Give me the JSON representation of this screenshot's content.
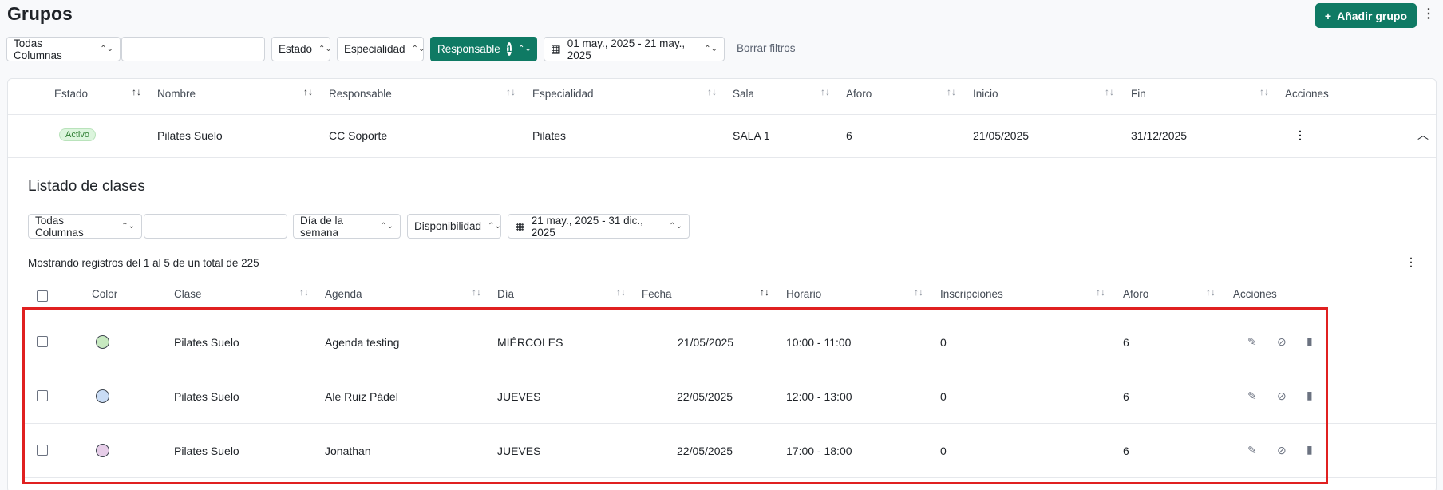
{
  "header": {
    "title": "Grupos",
    "add_label": "Añadir grupo",
    "add_icon": "plus-icon",
    "more_icon": "⋮"
  },
  "filters": {
    "column_select": "Todas Columnas",
    "search_placeholder": "",
    "estado": "Estado",
    "especialidad": "Especialidad",
    "responsable": "Responsable",
    "responsable_count": "1",
    "date_range": "01 may., 2025 - 21 may., 2025",
    "clear": "Borrar filtros"
  },
  "groups_table": {
    "columns": [
      "Estado",
      "Nombre",
      "Responsable",
      "Especialidad",
      "Sala",
      "Aforo",
      "Inicio",
      "Fin",
      "Acciones"
    ],
    "row": {
      "estado": "Activo",
      "nombre": "Pilates Suelo",
      "responsable": "CC Soporte",
      "especialidad": "Pilates",
      "sala": "SALA 1",
      "aforo": "6",
      "inicio": "21/05/2025",
      "fin": "31/12/2025",
      "actions_icon": "⋮",
      "expand_icon": "︿"
    }
  },
  "classes": {
    "title": "Listado de clases",
    "filters": {
      "column_select": "Todas Columnas",
      "dia": "Día de la semana",
      "disponibilidad": "Disponibilidad",
      "date_range": "21 may., 2025 - 31 dic., 2025"
    },
    "records_text": "Mostrando registros del 1 al 5 de un total de 225",
    "more_icon": "⋮",
    "columns": [
      "Color",
      "Clase",
      "Agenda",
      "Día",
      "Fecha",
      "Horario",
      "Inscripciones",
      "Aforo",
      "Acciones"
    ],
    "rows": [
      {
        "color": "#c7e9c0",
        "clase": "Pilates Suelo",
        "agenda": "Agenda testing",
        "dia": "MIÉRCOLES",
        "fecha": "21/05/2025",
        "horario": "10:00 - 11:00",
        "inscripciones": "0",
        "aforo": "6"
      },
      {
        "color": "#c9dcf5",
        "clase": "Pilates Suelo",
        "agenda": "Ale Ruiz Pádel",
        "dia": "JUEVES",
        "fecha": "22/05/2025",
        "horario": "12:00 - 13:00",
        "inscripciones": "0",
        "aforo": "6"
      },
      {
        "color": "#e6cde8",
        "clase": "Pilates Suelo",
        "agenda": "Jonathan",
        "dia": "JUEVES",
        "fecha": "22/05/2025",
        "horario": "17:00 - 18:00",
        "inscripciones": "0",
        "aforo": "6"
      }
    ]
  },
  "colors": {
    "brand": "#0f7a64",
    "highlight": "#e02020"
  }
}
